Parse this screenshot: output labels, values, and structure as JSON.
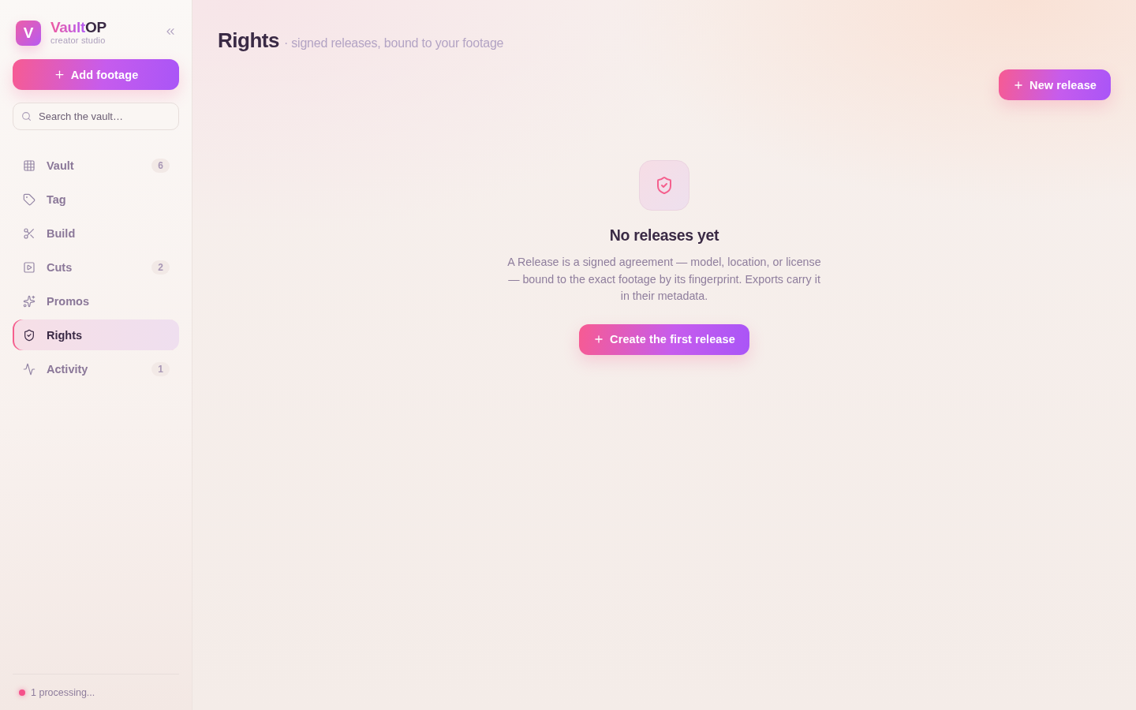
{
  "sidebar": {
    "brand": {
      "logo_letter": "V",
      "name_highlight": "Vault",
      "name_rest": "OP",
      "tagline": "creator studio"
    },
    "add_button": {
      "label": "Add footage"
    },
    "search": {
      "placeholder": "Search the vault…"
    },
    "nav": [
      {
        "label": "Vault",
        "count": "6",
        "selected": false
      },
      {
        "label": "Tag",
        "selected": false
      },
      {
        "label": "Build",
        "selected": false
      },
      {
        "label": "Cuts",
        "count": "2",
        "selected": false
      },
      {
        "label": "Promos",
        "selected": false
      },
      {
        "label": "Rights",
        "selected": true
      },
      {
        "label": "Activity",
        "count": "1",
        "selected": false
      }
    ],
    "status": {
      "text": "1 processing..."
    }
  },
  "page": {
    "title": "Rights",
    "subtitle": "· signed releases, bound to your footage",
    "new_button": {
      "label": "New release"
    },
    "empty_state": {
      "title": "No releases yet",
      "description": "A Release is a signed agreement — model, location, or license — bound to the exact footage by its fingerprint. Exports carry it in their metadata.",
      "button": {
        "label": "Create the first release"
      }
    }
  }
}
